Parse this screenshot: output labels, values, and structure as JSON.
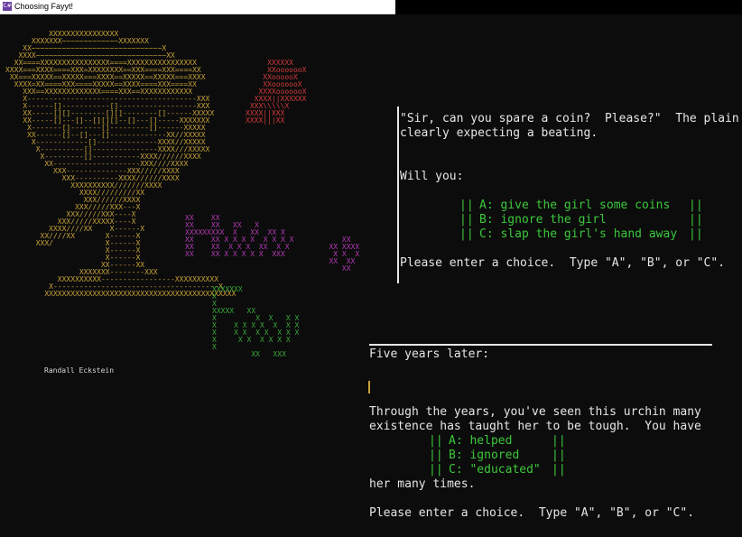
{
  "window": {
    "title": "Choosing Fayyt!",
    "app_icon_text": "C#"
  },
  "art": {
    "signature": "Randall Eckstein",
    "goblet": [
      "          XXXXXXXXXXXXXXXX",
      "      XXXXXXX~~~~~~~~~~~~~XXXXXXX",
      "    XX~~~~~~~~~~~~~~~~~~~~~~~~~~~~~~X",
      "   XXXX~~~~~~~~~~~~~~~~~~~~~~~~~~~~~~XX",
      "  XX====XXXXXXXXXXXXXXXX====XXXXXXXXXXXXXXXX",
      "XXXX===XXXX====XXX=XXXXXXXX==XXX====XXX====XX",
      " XX===XXXXX==XXXXX===XXXX==XXXXX==XXXXX===XXXX",
      "  XXXX=XX====XXX====XXXXX==XXXX====XXX====XX",
      "    XXX==XXXXXXXXXXXXX====XXX==XXXXXXXXXXXX",
      "    X---------------------------------------XXX",
      "    X------[]-----------[]------------------XXX",
      "    XX-----[][]--------[][]--------[]------XXXXX",
      "    XX-----[]---[]--[][][]--[]---[]-----XXXXXXX",
      "     X-------[]-------[]---------[]------XXXXX",
      "     XX------[]--[]---[]-------------XX//XXXXX",
      "      X------------[]--------------XXXX//XXXXX",
      "       X----------[]---------------XXXX///XXXXX",
      "        X---------[]-----------XXXX//////XXXX",
      "         XX--------------------XXX////XXXX",
      "           XXX--------------XXX/////XXXX",
      "             XXX----------XXXX//////XXXX",
      "               XXXXXXXXXX///////XXXX",
      "                 XXXX/////////XX",
      "                  XXX//////XXXX",
      "                XXX/////XXX---X",
      "              XXX/////XXX----X",
      "            XXX/////XXXXX----X",
      "          XXXX////XX    X------X",
      "        XX////XX       X------X",
      "       XXX/            X------X",
      "                       X------X",
      "                       X------X",
      "                      XX------XX",
      "                 XXXXXXX--------XXX",
      "            XXXXXXXXXX-----------------XXXXXXXXXX",
      "          X--------------------------------------X",
      "         XXXXXXXXXXXXXXXXXXXXXXXXXXXXXXXXXXXXXXXXXXXX"
    ],
    "hand": [
      "     XXXXXX",
      "     XXooooooX",
      "    XXoooooX",
      "    XXooooooX",
      "   XXXXooooooX",
      "  XXXX||XXXXXX",
      " XXX\\\\\\\\\\X",
      "XXXX||XXX",
      "XXXX|||XX"
    ],
    "fayyt": [
      "XX    XX",
      "XX    XX   XX   X",
      "XXXXXXXXX  X   XX  XX X",
      "XX    XX X X X X  X X X X",
      "XX    XX  X X X  XX  X X",
      "XX    XX X X X X X  XXX"
    ],
    "fayyt_right": [
      "      XX",
      "   XX XXXX",
      "    X X  X",
      "   XX  XX",
      "      XX"
    ],
    "fate": [
      "XXXXXXX",
      "X",
      "X",
      "XXXXX   XX",
      "X         X  X   X X",
      "X    X X X X  X  X X",
      "X    X X  X X  X X X",
      "X     X X  X X X X",
      "X",
      "         XX   XXX"
    ]
  },
  "scene1": {
    "line1": "\"Sir, can you spare a coin?  Please?\"  The plain",
    "line2": "clearly expecting a beating.",
    "prompt": "Will you:",
    "option_a": "A: give the girl some coins",
    "option_b": "B: ignore the girl",
    "option_c": "C: slap the girl's hand away",
    "instruction": "Please enter a choice.  Type \"A\", \"B\", or \"C\"."
  },
  "scene2": {
    "heading": "Five years later:",
    "line1": "Through the years, you've seen this urchin many",
    "line2": "existence has taught her to be tough.  You have",
    "option_a": "A: helped",
    "option_b": "B: ignored",
    "option_c": "C: \"educated\"",
    "line3": "her many times.",
    "instruction": "Please enter a choice.  Type \"A\", \"B\", or \"C\"."
  },
  "colors": {
    "background": "#0c0c0c",
    "text": "#e6e6e6",
    "option_green": "#3cc83c",
    "goblet_gold": "#c8a23a",
    "magenta": "#b23ab4",
    "red": "#d23a3a",
    "blue": "#3a5ad2"
  }
}
